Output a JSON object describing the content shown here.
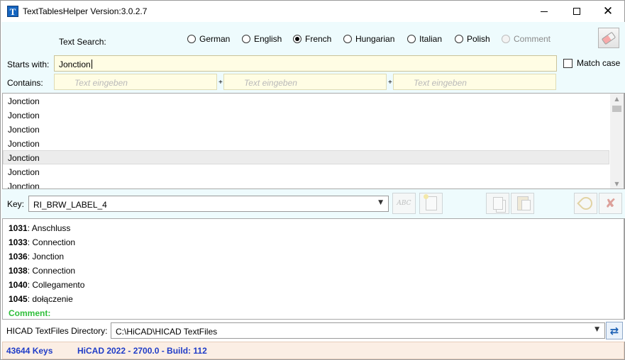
{
  "window": {
    "title": "TextTablesHelper Version:3.0.2.7",
    "app_icon_letter": "T"
  },
  "search": {
    "text_search_label": "Text Search:",
    "languages": [
      {
        "label": "German",
        "selected": false,
        "enabled": true
      },
      {
        "label": "English",
        "selected": false,
        "enabled": true
      },
      {
        "label": "French",
        "selected": true,
        "enabled": true
      },
      {
        "label": "Hungarian",
        "selected": false,
        "enabled": true
      },
      {
        "label": "Italian",
        "selected": false,
        "enabled": true
      },
      {
        "label": "Polish",
        "selected": false,
        "enabled": true
      },
      {
        "label": "Comment",
        "selected": false,
        "enabled": false
      }
    ],
    "starts_with_label": "Starts with:",
    "starts_with_value": "Jonction",
    "match_case_label": "Match case",
    "match_case_checked": false,
    "contains_label": "Contains:",
    "contains_placeholder": "Text eingeben",
    "plus_symbol": "+"
  },
  "results": {
    "items": [
      "Jonction",
      "Jonction",
      "Jonction",
      "Jonction",
      "Jonction",
      "Jonction",
      "Jonction"
    ],
    "hovered_index": 4
  },
  "key": {
    "label": "Key:",
    "value": "RI_BRW_LABEL_4"
  },
  "translations": [
    {
      "code": "1031",
      "text": "Anschluss"
    },
    {
      "code": "1033",
      "text": "Connection"
    },
    {
      "code": "1036",
      "text": "Jonction"
    },
    {
      "code": "1038",
      "text": "Connection"
    },
    {
      "code": "1040",
      "text": "Collegamento"
    },
    {
      "code": "1045",
      "text": "dołączenie"
    }
  ],
  "comment_label": "Comment:",
  "directory": {
    "label": "HICAD TextFiles Directory:",
    "value": "C:\\HiCAD\\HICAD TextFiles"
  },
  "status": {
    "keys_count": "43644 Keys",
    "version": "HiCAD 2022 - 2700.0 - Build: 112"
  },
  "colors": {
    "panel_bg": "#eefbfd",
    "input_bg": "#fffde4",
    "comment_green": "#2fbf3a",
    "status_blue": "#1f3cc7",
    "status_bg": "#fbeee4"
  }
}
